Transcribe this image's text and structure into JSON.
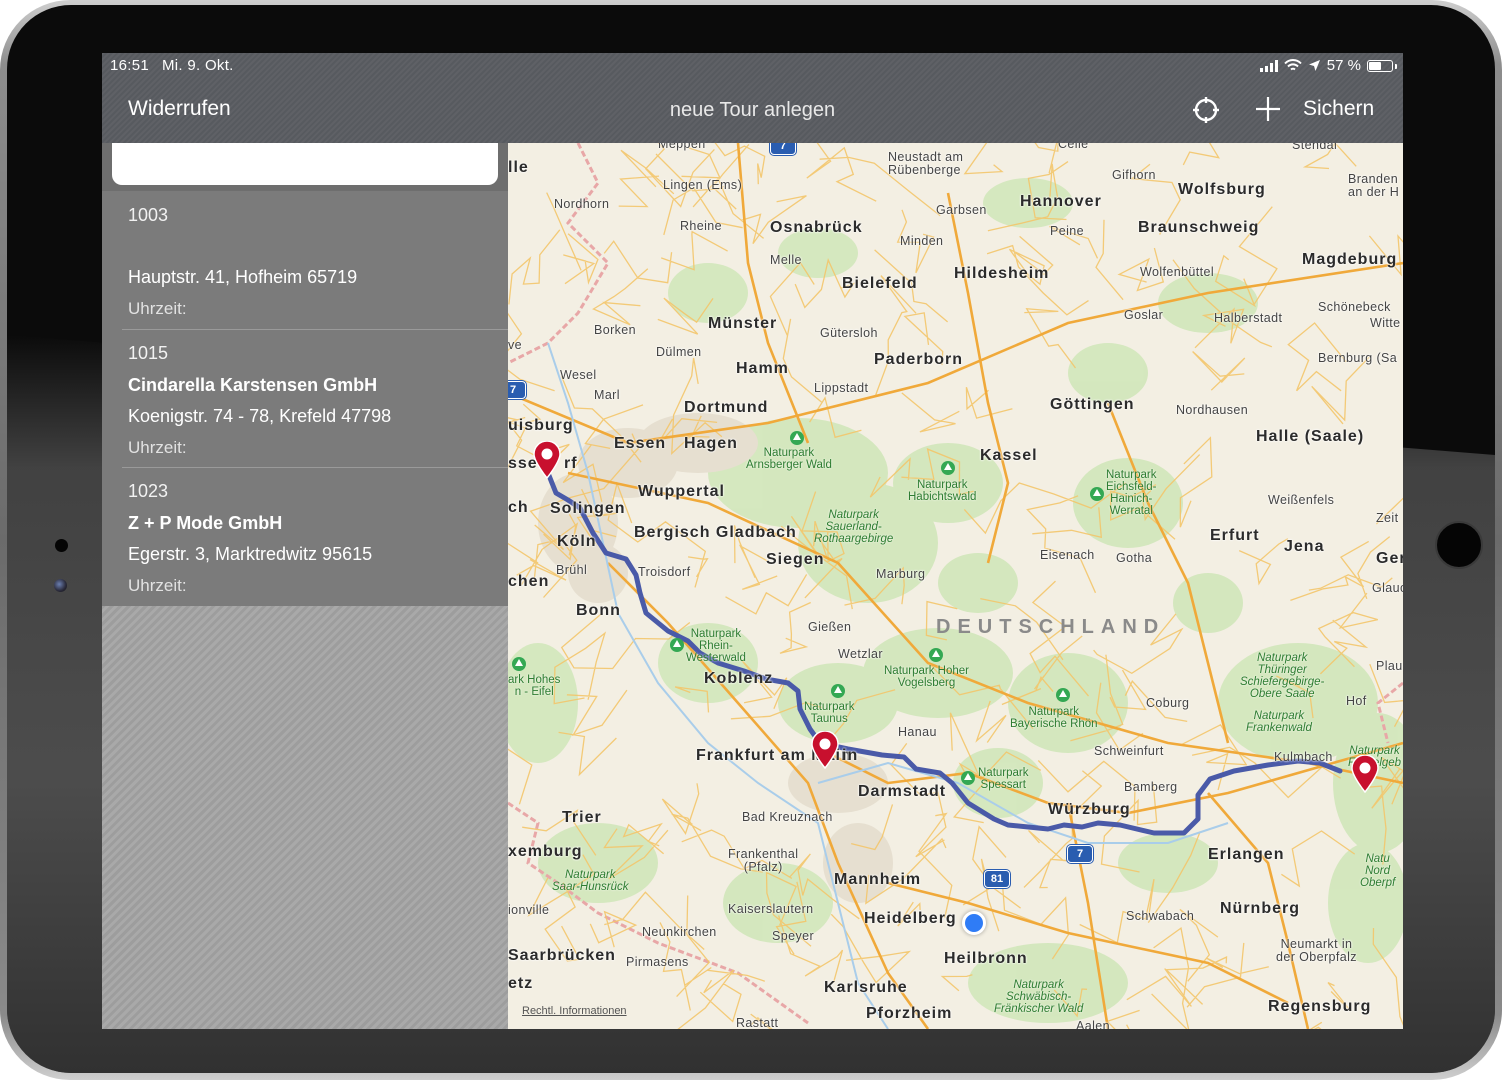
{
  "status_bar": {
    "time": "16:51",
    "date": "Mi. 9. Okt.",
    "battery": "57 %",
    "battery_level": 0.57
  },
  "nav": {
    "back_label": "Widerrufen",
    "title": "neue Tour anlegen",
    "save_label": "Sichern",
    "locate_icon": "crosshair-icon",
    "add_icon": "plus-icon"
  },
  "search": {
    "value": "",
    "placeholder": ""
  },
  "stops": [
    {
      "id": "1003",
      "name": "",
      "address": "Hauptstr. 41, Hofheim 65719",
      "time_label": "Uhrzeit:"
    },
    {
      "id": "1015",
      "name": "Cindarella Karstensen GmbH",
      "address": "Koenigstr. 74 - 78, Krefeld 47798",
      "time_label": "Uhrzeit:"
    },
    {
      "id": "1023",
      "name": "Z + P Mode GmbH",
      "address": "Egerstr. 3, Marktredwitz 95615",
      "time_label": "Uhrzeit:"
    }
  ],
  "map": {
    "country_label": "DEUTSCHLAND",
    "legal_link": "Rechtl. Informationen",
    "route_color": "#4a5aa8",
    "pin_color": "#c8102e",
    "cities": {
      "hannover": "Hannover",
      "wolfsburg": "Wolfsburg",
      "braunschweig": "Braunschweig",
      "magdeburg": "Magdeburg",
      "osnabrueck": "Osnabrück",
      "bielefeld": "Bielefeld",
      "hildesheim": "Hildesheim",
      "muenster": "Münster",
      "paderborn": "Paderborn",
      "hamm": "Hamm",
      "dortmund": "Dortmund",
      "goettingen": "Göttingen",
      "halle": "Halle (Saale)",
      "essen": "Essen",
      "hagen": "Hagen",
      "wuppertal": "Wuppertal",
      "kassel": "Kassel",
      "solingen": "Solingen",
      "bergisch": "Bergisch Gladbach",
      "koeln": "Köln",
      "erfurt": "Erfurt",
      "jena": "Jena",
      "siegen": "Siegen",
      "bonn": "Bonn",
      "koblenz": "Koblenz",
      "frankfurt": "Frankfurt am Main",
      "darmstadt": "Darmstadt",
      "wuerzburg": "Würzburg",
      "trier": "Trier",
      "erlangen": "Erlangen",
      "mannheim": "Mannheim",
      "heidelberg": "Heidelberg",
      "nuernberg": "Nürnberg",
      "heilbronn": "Heilbronn",
      "saarbruecken": "Saarbrücken",
      "karlsruhe": "Karlsruhe",
      "pforzheim": "Pforzheim",
      "regensburg": "Regensburg",
      "duisburg": "uisburg",
      "duesseldorf_part1": "sseld",
      "duesseldorf_part2": "rf",
      "aachen": "chen",
      "luxemburg": "xemburg",
      "mainz_part": "in",
      "gera": "Gera"
    },
    "towns": {
      "meppen": "Meppen",
      "lingen": "Lingen (Ems)",
      "nordhorn": "Nordhorn",
      "rheine": "Rheine",
      "neustadt_ruebenberge": "Neustadt am\nRübenberge",
      "gifhorn": "Gifhorn",
      "garbsen": "Garbsen",
      "peine": "Peine",
      "minden": "Minden",
      "melle": "Melle",
      "wolfenbuettel": "Wolfenbüttel",
      "schoenebeck": "Schönebeck",
      "goslar": "Goslar",
      "halberstadt": "Halberstadt",
      "bernburg": "Bernburg (Sa",
      "borken": "Borken",
      "guetersloh": "Gütersloh",
      "duelmen": "Dülmen",
      "wesel": "Wesel",
      "marl": "Marl",
      "lippstadt": "Lippstadt",
      "nordhausen": "Nordhausen",
      "weissenfels": "Weißenfels",
      "eisenach": "Eisenach",
      "gotha": "Gotha",
      "bruehl": "Brühl",
      "troisdorf": "Troisdorf",
      "marburg": "Marburg",
      "giessen": "Gießen",
      "wetzlar": "Wetzlar",
      "hanau": "Hanau",
      "coburg": "Coburg",
      "schweinfurt": "Schweinfurt",
      "bamberg": "Bamberg",
      "kulmbach": "Kulmbach",
      "hof": "Hof",
      "bad_kreuznach": "Bad Kreuznach",
      "frankenthal": "Frankenthal\n(Pfalz)",
      "kaiserslautern": "Kaiserslautern",
      "neunkirchen": "Neunkirchen",
      "speyer": "Speyer",
      "schwabach": "Schwabach",
      "pirmasens": "Pirmasens",
      "neumarkt": "Neumarkt in\nder Oberpfalz",
      "rastatt": "Rastatt",
      "aalen": "Aalen",
      "stendal": "Stendal",
      "brandenburg": "Branden\nan der H",
      "witte": "Witte",
      "zeit": "Zeit",
      "glauc": "Glauc",
      "plau": "Plau",
      "celle": "Celle",
      "lle": "lle",
      "ve": "ve",
      "ch": "ch",
      "ionville": "ionville",
      "etz": "etz"
    },
    "parks": {
      "arnsberger": "Naturpark\nArnsberger Wald",
      "sauerland": "Naturpark\nSauerland-\nRothaargebirge",
      "habichtswald": "Naturpark\nHabichtswald",
      "eichsfeld": "Naturpark\nEichsfeld-\nHainich-\nWerratal",
      "rhein_westerwald": "Naturpark\nRhein-\nWesterwald",
      "hohes_venn": "ark Hohes\nn - Eifel",
      "hoher_vogelsberg": "Naturpark Hoher\nVogelsberg",
      "taunus": "Naturpark\nTaunus",
      "bayerische_rhoen": "Naturpark\nBayerische Rhön",
      "spessart": "Naturpark\nSpessart",
      "thueringer": "Naturpark\nThüringer\nSchiefergebirge-\nObere Saale",
      "frankenwald": "Naturpark\nFrankenwald",
      "fichtelgebirge": "Naturpark\nFichtelgeb",
      "saar_hunsrueck": "Naturpark\nSaar-Hunsrück",
      "schwaebisch": "Naturpark\nSchwäbisch-\nFränkischer Wald",
      "noerdlicher": "Natu\nNord\nOberpf"
    },
    "motorway_labels": [
      "7",
      "81",
      "7",
      "7"
    ]
  }
}
